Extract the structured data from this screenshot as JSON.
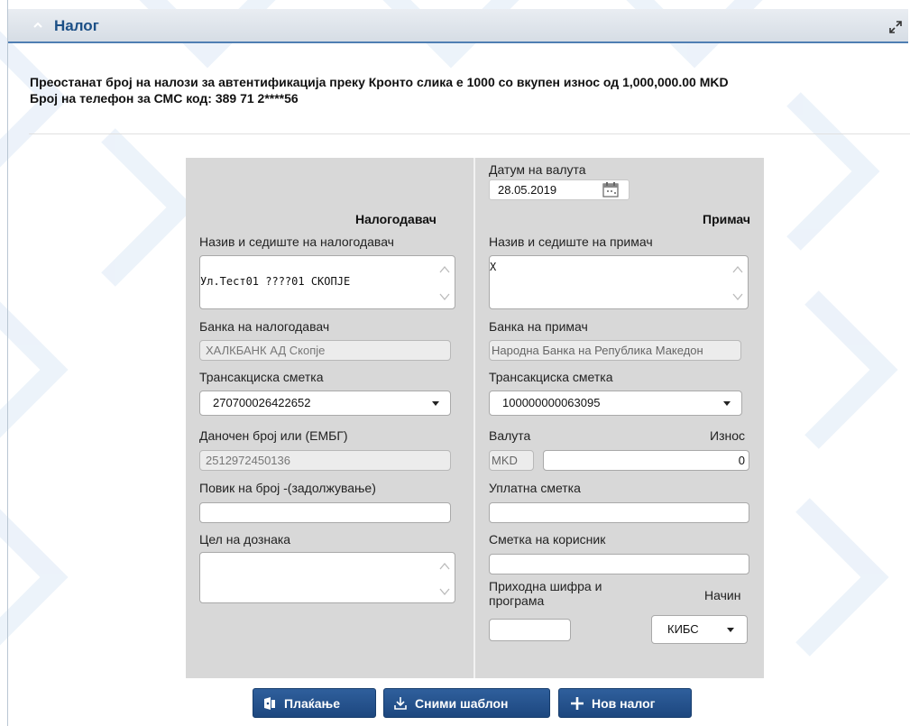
{
  "header": {
    "title": "Налог"
  },
  "info": {
    "line1": "Преостанат број на налози за автентификација преку Кронто слика е 1000 со вкупен износ од 1,000,000.00 MKD",
    "line2": "Број на телефон за СМС код: 389 71 2****56"
  },
  "form": {
    "value_date_label": "Датум на валута",
    "value_date": "28.05.2019",
    "payer": {
      "heading": "Налогодавач",
      "name_label": "Назив и седиште на налогодавач",
      "name_value": "Ул.Тест01 ????01 СКОПЈЕ",
      "bank_label": "Банка на налогодавач",
      "bank_value": "ХАЛКБАНК АД Скопје",
      "account_label": "Трансакциска сметка",
      "account_value": "270700026422652",
      "tax_label": "Даночен број или (ЕМБГ)",
      "tax_value": "2512972450136",
      "reference_label": "Повик на број -(задолжување)",
      "reference_value": "",
      "purpose_label": "Цел на дознака",
      "purpose_value": ""
    },
    "payee": {
      "heading": "Примач",
      "name_label": "Назив и седиште на примач",
      "name_value": "X",
      "bank_label": "Банка на примач",
      "bank_value": "Народна Банка на Република Македон",
      "account_label": "Трансакциска сметка",
      "account_value": "100000000063095",
      "currency_label": "Валута",
      "currency_value": "MKD",
      "amount_label": "Износ",
      "amount_value": "0",
      "payment_account_label": "Уплатна сметка",
      "payment_account_value": "",
      "user_account_label": "Сметка на корисник",
      "user_account_value": "",
      "revenue_code_label_1": "Приходна шифра и",
      "revenue_code_label_2": "програма",
      "revenue_code_value": "",
      "method_label": "Начин",
      "method_value": "КИБС"
    }
  },
  "buttons": {
    "pay": "Плаќање",
    "save_template": "Сними шаблон",
    "new_order": "Нов налог"
  },
  "colors": {
    "accent": "#1d477f",
    "header_text": "#1b4f86",
    "panel": "#d8d8d8"
  },
  "icons": {
    "collapse": "chevron-up-icon",
    "expand": "expand-icon",
    "calendar": "calendar-icon",
    "pay": "payment-icon",
    "save": "download-icon",
    "new": "plus-icon"
  }
}
